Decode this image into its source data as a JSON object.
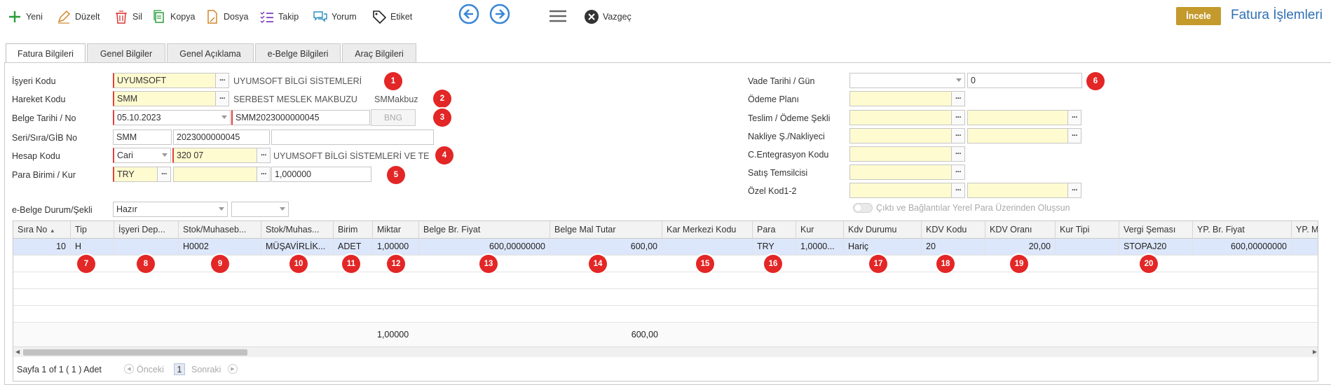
{
  "toolbar": {
    "new_label": "Yeni",
    "edit_label": "Düzelt",
    "delete_label": "Sil",
    "copy_label": "Kopya",
    "file_label": "Dosya",
    "track_label": "Takip",
    "comment_label": "Yorum",
    "tag_label": "Etiket",
    "cancel_label": "Vazgeç",
    "inspect_label": "İncele",
    "page_title": "Fatura İşlemleri"
  },
  "tabs": [
    "Fatura Bilgileri",
    "Genel Bilgiler",
    "Genel Açıklama",
    "e-Belge Bilgileri",
    "Araç Bilgileri"
  ],
  "form_left": {
    "isyeri_label": "İşyeri Kodu",
    "isyeri_value": "UYUMSOFT",
    "isyeri_desc": "UYUMSOFT BİLGİ SİSTEMLERİ",
    "hareket_label": "Hareket Kodu",
    "hareket_value": "SMM",
    "hareket_desc": "SERBEST MESLEK MAKBUZU",
    "hareket_short": "SMMakbuz",
    "belge_label": "Belge Tarihi / No",
    "belge_date": "05.10.2023",
    "belge_no": "SMM2023000000045",
    "bng_label": "BNG",
    "seri_label": "Seri/Sıra/GİB No",
    "seri_value": "SMM",
    "sira_value": "2023000000045",
    "gib_value": "",
    "hesap_label": "Hesap Kodu",
    "hesap_type": "Cari",
    "hesap_value": "320 07",
    "hesap_desc": "UYUMSOFT BİLGİ SİSTEMLERİ VE TE",
    "para_label": "Para Birimi / Kur",
    "para_value": "TRY",
    "kur_value": "1,000000",
    "ebelge_label": "e-Belge Durum/Şekli",
    "ebelge_durum": "Hazır",
    "ebelge_sekil": ""
  },
  "form_right": {
    "vade_label": "Vade Tarihi / Gün",
    "vade_gun": "0",
    "odeme_plan_label": "Ödeme Planı",
    "teslim_label": "Teslim / Ödeme Şekli",
    "nakliye_label": "Nakliye Ş./Nakliyeci",
    "entegrasyon_label": "C.Entegrasyon Kodu",
    "satis_label": "Satış Temsilcisi",
    "ozel_label": "Özel Kod1-2",
    "toggle_label": "Çıktı ve Bağlantılar Yerel Para Üzerinden Oluşsun"
  },
  "badges": [
    "1",
    "2",
    "3",
    "4",
    "5",
    "6",
    "7",
    "8",
    "9",
    "10",
    "11",
    "12",
    "13",
    "14",
    "15",
    "16",
    "17",
    "18",
    "19",
    "20"
  ],
  "grid": {
    "headers": [
      "Sıra No",
      "Tip",
      "İşyeri Dep...",
      "Stok/Muhaseb...",
      "Stok/Muhas...",
      "Birim",
      "Miktar",
      "Belge Br. Fiyat",
      "Belge Mal Tutar",
      "Kar Merkezi Kodu",
      "Para",
      "Kur",
      "Kdv Durumu",
      "KDV Kodu",
      "KDV Oranı",
      "Kur Tipi",
      "Vergi Şeması",
      "YP. Br. Fiyat",
      "YP. M"
    ],
    "row": [
      "10",
      "H",
      "",
      "H0002",
      "MÜŞAVİRLİK...",
      "ADET",
      "1,00000",
      "600,00000000",
      "600,00",
      "",
      "TRY",
      "1,0000...",
      "Hariç",
      "20",
      "20,00",
      "",
      "STOPAJ20",
      "600,00000000",
      ""
    ],
    "total_miktar": "1,00000",
    "total_tutar": "600,00",
    "pager_text": "Sayfa 1 of 1 ( 1 ) Adet",
    "prev_label": "Önceki",
    "page_num": "1",
    "next_label": "Sonraki"
  },
  "colors": {
    "accent": "#2f6fb3",
    "badge": "#e32626",
    "incele": "#c49a2d",
    "required": "#e04040",
    "selected_row": "#dde7fb"
  }
}
